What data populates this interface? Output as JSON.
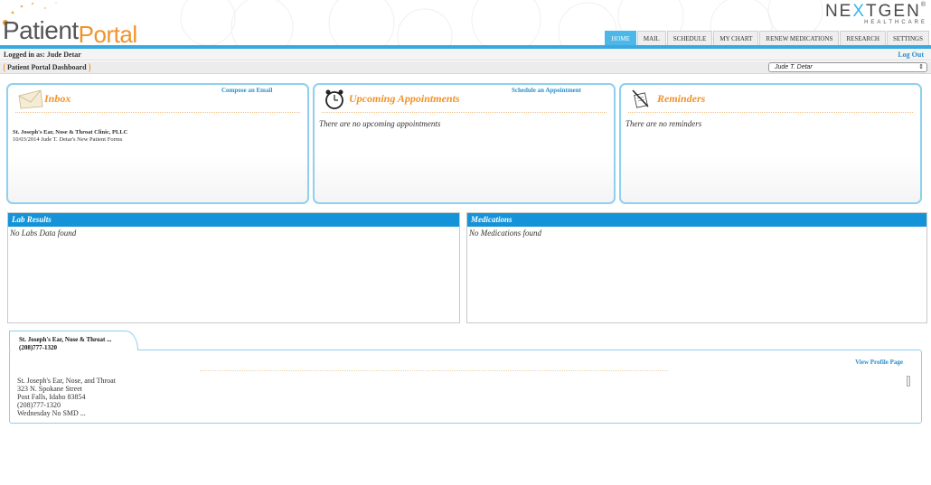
{
  "header": {
    "logo_part1": "Patient",
    "logo_part2": "Portal",
    "brand_name_start": "NE",
    "brand_name_x": "X",
    "brand_name_end": "TGEN",
    "brand_reg": "®",
    "brand_sub": "HEALTHCARE"
  },
  "nav": {
    "tabs": [
      "HOME",
      "MAIL",
      "SCHEDULE",
      "MY CHART",
      "RENEW MEDICATIONS",
      "RESEARCH",
      "SETTINGS"
    ],
    "active": "HOME"
  },
  "session": {
    "logged_in": "Logged in as: Jude Detar",
    "logout": "Log Out"
  },
  "dashboard": {
    "breadcrumb": "Patient Portal Dashboard",
    "patient_selected": "Jude T. Detar",
    "select_arrow": "⇕"
  },
  "inbox": {
    "title": "Inbox",
    "action": "Compose an Email",
    "item_from": "St. Joseph's Ear, Nose & Throat Clinic, PLLC",
    "item_date_subject": "10/03/2014    Jude T. Detar's New Patient Forms"
  },
  "appointments": {
    "title": "Upcoming Appointments",
    "action": "Schedule an Appointment",
    "empty": "There are no upcoming appointments"
  },
  "reminders": {
    "title": "Reminders",
    "empty": "There are no reminders"
  },
  "lab_results": {
    "title": "Lab Results",
    "empty": "No Labs Data found"
  },
  "medications": {
    "title": "Medications",
    "empty": "No Medications found"
  },
  "practice": {
    "tab_name": "St. Joseph's Ear, Nose & Throat ...",
    "tab_phone": "(208)777-1320",
    "view_profile": "View Profile Page",
    "address_lines": [
      "St. Joseph's Ear, Nose, and Throat",
      "323 N. Spokane Street",
      "Post Falls, Idaho 83854",
      "(208)777-1320",
      "Wednesday No SMD  ..."
    ]
  },
  "colors": {
    "accent_orange": "#f0932b",
    "accent_blue": "#1493d8",
    "link_blue": "#2a8fcc",
    "card_border": "#8fd0ee"
  }
}
